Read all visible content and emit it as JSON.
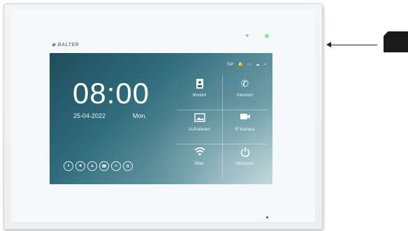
{
  "device": {
    "brand": "BALTER",
    "leds": {
      "left_icon": "person-icon",
      "right_icon": "wifi-icon"
    }
  },
  "screen": {
    "status_bar": [
      "SIP",
      "bell-icon",
      "sd-card-icon",
      "cloud-icon",
      "wifi-icon"
    ],
    "status_sip": "SIP",
    "time": "08:00",
    "date": "25-04-2022",
    "day": "Mon.",
    "tiles": [
      {
        "label": "Monitor",
        "icon": "monitor-icon"
      },
      {
        "label": "Interkom",
        "icon": "phone-icon"
      },
      {
        "label": "Aufnahmen",
        "icon": "gallery-icon"
      },
      {
        "label": "IP Kamera",
        "icon": "camera-icon"
      },
      {
        "label": "Wlan",
        "icon": "wifi-icon"
      },
      {
        "label": "Verlassen",
        "icon": "power-icon"
      }
    ],
    "quick_buttons": [
      "bell-icon",
      "video-icon",
      "shirt-icon",
      "call-log-icon",
      "voicemail-icon",
      "settings-icon"
    ]
  },
  "colors": {
    "screen_dark": "#1f4d5d",
    "screen_light": "#c2d7dc",
    "led_purple": "#c7a9e6",
    "led_green": "#7fe08c"
  },
  "annotation": {
    "arrow_icon": "arrow-left-icon",
    "card_icon": "sd-card-icon"
  }
}
